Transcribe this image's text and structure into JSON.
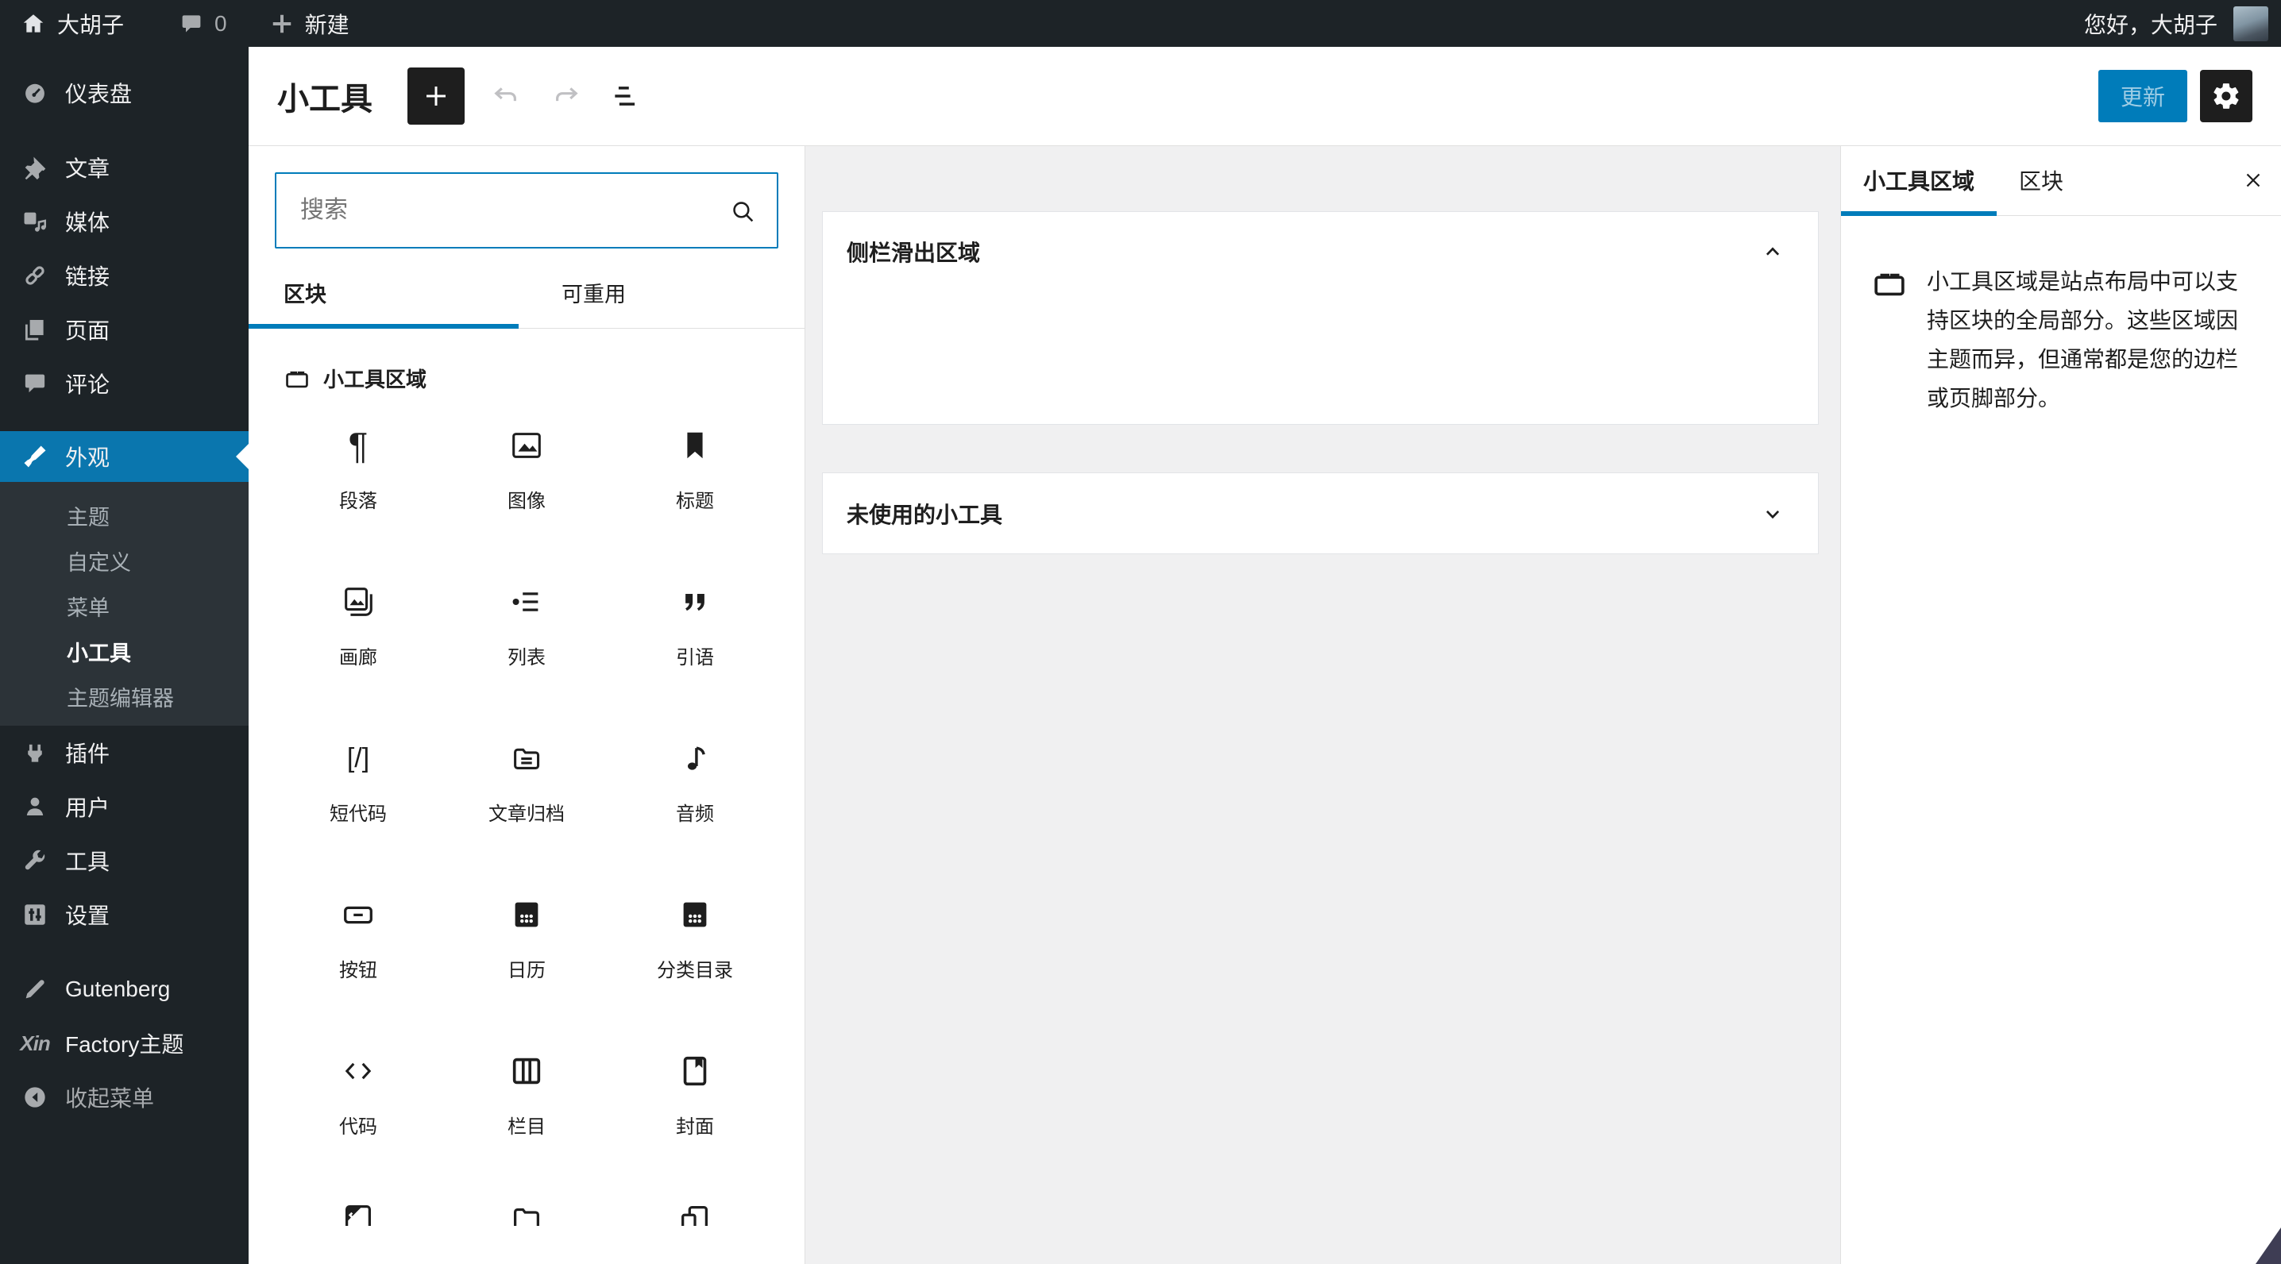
{
  "admin_bar": {
    "site_name": "大胡子",
    "comment_count": "0",
    "new_label": "新建",
    "howdy": "您好，大胡子"
  },
  "sidebar": {
    "dashboard": "仪表盘",
    "posts": "文章",
    "media": "媒体",
    "links": "链接",
    "pages": "页面",
    "comments": "评论",
    "appearance": "外观",
    "appearance_submenu": {
      "themes": "主题",
      "customize": "自定义",
      "menus": "菜单",
      "widgets": "小工具",
      "theme_editor": "主题编辑器"
    },
    "plugins": "插件",
    "users": "用户",
    "tools": "工具",
    "settings": "设置",
    "gutenberg": "Gutenberg",
    "xin_logo": "Xin",
    "xin_theme": "Factory主题",
    "collapse": "收起菜单"
  },
  "header": {
    "title": "小工具",
    "update_label": "更新"
  },
  "inserter": {
    "search_placeholder": "搜索",
    "tab_blocks": "区块",
    "tab_reusable": "可重用",
    "section_title": "小工具区域",
    "blocks": [
      {
        "label": "段落"
      },
      {
        "label": "图像"
      },
      {
        "label": "标题"
      },
      {
        "label": "画廊"
      },
      {
        "label": "列表"
      },
      {
        "label": "引语"
      },
      {
        "label": "短代码"
      },
      {
        "label": "文章归档"
      },
      {
        "label": "音频"
      },
      {
        "label": "按钮"
      },
      {
        "label": "日历"
      },
      {
        "label": "分类目录"
      },
      {
        "label": "代码"
      },
      {
        "label": "栏目"
      },
      {
        "label": "封面"
      }
    ]
  },
  "icons": {
    "paragraph_glyph": "¶",
    "shortcode_glyph": "[/]"
  },
  "main": {
    "widget_area_title": "侧栏滑出区域",
    "inactive_widgets_title": "未使用的小工具"
  },
  "settings_panel": {
    "tab_widget_area": "小工具区域",
    "tab_block": "区块",
    "description": "小工具区域是站点布局中可以支持区块的全局部分。这些区域因主题而异，但通常都是您的边栏或页脚部分。"
  },
  "colors": {
    "accent": "#007cba",
    "menu_active": "#0a76ae",
    "admin_bg": "#1d2327",
    "submenu_bg": "#2c3338",
    "canvas_bg": "#f0f0f1",
    "button_dark": "#1e1e1e"
  }
}
